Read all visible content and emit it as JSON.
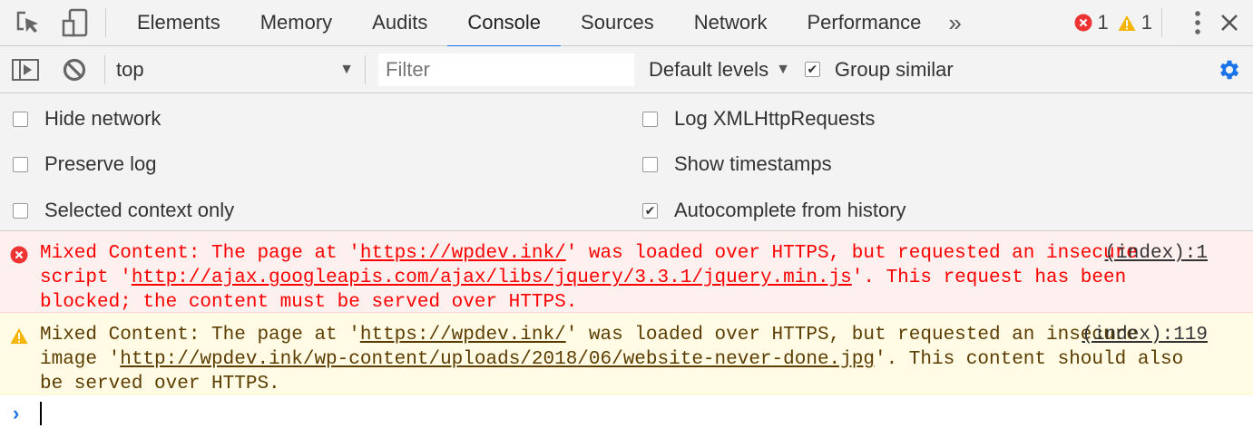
{
  "tabs": [
    "Elements",
    "Memory",
    "Audits",
    "Console",
    "Sources",
    "Network",
    "Performance"
  ],
  "active_tab": "Console",
  "counts": {
    "errors": "1",
    "warnings": "1"
  },
  "toolbar": {
    "context": "top",
    "filter_placeholder": "Filter",
    "levels": "Default levels",
    "group_similar": "Group similar"
  },
  "settings": {
    "hide_network": "Hide network",
    "preserve_log": "Preserve log",
    "selected_context": "Selected context only",
    "log_xhr": "Log XMLHttpRequests",
    "show_timestamps": "Show timestamps",
    "autocomplete": "Autocomplete from history"
  },
  "messages": [
    {
      "type": "error",
      "pre": "Mixed Content: The page at '",
      "url1": "https://wpdev.ink/",
      "mid": "' was loaded over HTTPS, but requested an insecure script '",
      "url2": "http://ajax.googleapis.com/ajax/libs/jquery/3.3.1/jquery.min.js",
      "post": "'. This request has been blocked; the content must be served over HTTPS.",
      "source": "(index):1"
    },
    {
      "type": "warning",
      "pre": "Mixed Content: The page at '",
      "url1": "https://wpdev.ink/",
      "mid": "' was loaded over HTTPS, but requested an insecure image '",
      "url2": "http://wpdev.ink/wp-content/uploads/2018/06/website-never-done.jpg",
      "post": "'. This content should also be served over HTTPS.",
      "source": "(index):119"
    }
  ],
  "colors": {
    "accent": "#1a73e8",
    "error": "#ff0000",
    "warning": "#f4b400"
  }
}
